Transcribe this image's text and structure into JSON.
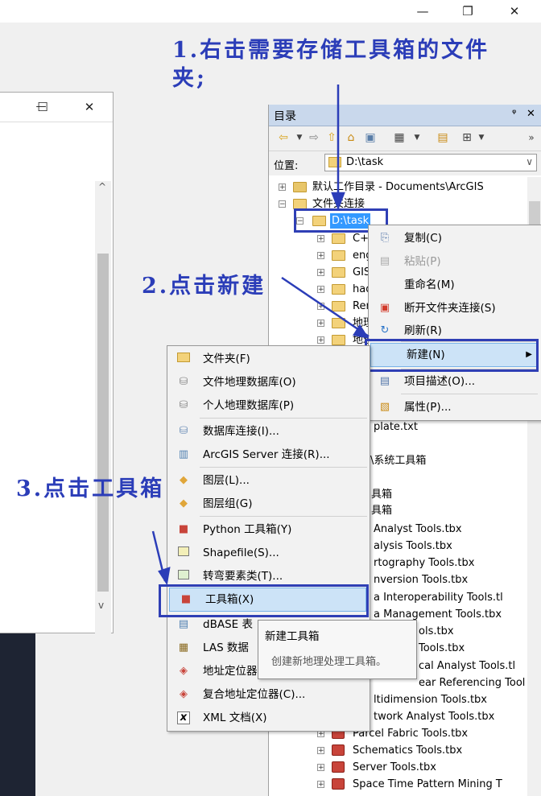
{
  "window": {
    "minimize_glyph": "—",
    "maximize_glyph": "❐",
    "close_glyph": "✕"
  },
  "left_window": {
    "minimize_glyph": "—",
    "maximize_glyph": "☐",
    "close_glyph": "✕",
    "scroll_up": "^",
    "scroll_down": "v"
  },
  "catalog": {
    "title": "目录",
    "pin_glyph": "ᵠ",
    "close_glyph": "✕",
    "location_label": "位置:",
    "location_value": "D:\\task",
    "tree": {
      "default_workspace": "默认工作目录 - Documents\\ArcGIS",
      "folder_connections": "文件夹连接",
      "task": "D:\\task",
      "children": [
        "C+",
        "eng",
        "GIS",
        "had",
        "Rer",
        "地理",
        "地理"
      ],
      "template": "plate.txt",
      "system_toolboxes": "\\系统工具箱",
      "toolbox_a": "具箱",
      "toolbox_b": "具箱",
      "items": [
        "Analyst Tools.tbx",
        "alysis Tools.tbx",
        "rtography Tools.tbx",
        "nversion Tools.tbx",
        "a Interoperability Tools.tl",
        "a Management Tools.tbx",
        "ols.tbx",
        "Tools.tbx",
        "cal Analyst Tools.tl",
        "ear Referencing Tools.tbx",
        "ltidimension Tools.tbx",
        "twork Analyst Tools.tbx",
        "Parcel Fabric Tools.tbx",
        "Schematics Tools.tbx",
        "Server Tools.tbx",
        "Space Time Pattern Mining T"
      ]
    }
  },
  "context_menu": {
    "items": [
      {
        "label": "复制(C)",
        "icon": "copy-icon",
        "disabled": false
      },
      {
        "label": "粘贴(P)",
        "icon": "paste-icon",
        "disabled": true
      },
      {
        "label": "重命名(M)",
        "icon": "",
        "disabled": false
      },
      {
        "label": "断开文件夹连接(S)",
        "icon": "disconnect-icon",
        "disabled": false
      },
      {
        "label": "刷新(R)",
        "icon": "refresh-icon",
        "disabled": false
      },
      {
        "label": "新建(N)",
        "icon": "",
        "disabled": false
      },
      {
        "label": "项目描述(O)...",
        "icon": "description-icon",
        "disabled": false
      },
      {
        "label": "属性(P)...",
        "icon": "properties-icon",
        "disabled": false
      }
    ],
    "submenu_arrow": "▶"
  },
  "new_submenu": {
    "items": [
      {
        "label": "文件夹(F)",
        "icon": "folder-icon"
      },
      {
        "label": "文件地理数据库(O)",
        "icon": "file-geodatabase-icon"
      },
      {
        "label": "个人地理数据库(P)",
        "icon": "personal-geodatabase-icon"
      },
      {
        "label": "数据库连接(I)...",
        "icon": "database-connection-icon"
      },
      {
        "label": "ArcGIS Server 连接(R)...",
        "icon": "server-connection-icon"
      },
      {
        "label": "图层(L)...",
        "icon": "layer-icon"
      },
      {
        "label": "图层组(G)",
        "icon": "layer-group-icon"
      },
      {
        "label": "Python 工具箱(Y)",
        "icon": "python-toolbox-icon"
      },
      {
        "label": "Shapefile(S)...",
        "icon": "shapefile-icon"
      },
      {
        "label": "转弯要素类(T)...",
        "icon": "turn-feature-icon"
      },
      {
        "label": "工具箱(X)",
        "icon": "toolbox-icon"
      },
      {
        "label": "dBASE 表",
        "icon": "dbase-icon"
      },
      {
        "label": "LAS 数据集",
        "icon": "las-dataset-icon"
      },
      {
        "label": "地址定位器",
        "icon": "address-locator-icon"
      },
      {
        "label": "复合地址定位器(C)...",
        "icon": "composite-locator-icon"
      },
      {
        "label": "XML 文档(X)",
        "icon": "xml-document-icon"
      }
    ]
  },
  "tooltip": {
    "title": "新建工具箱",
    "description": "创建新地理处理工具箱。"
  },
  "annotations": {
    "step1_line1": "1.右击需要存储工具箱的文件",
    "step1_line2": "夹;",
    "step2": "2.点击新建",
    "step3": "3.点击工具箱",
    "color": "#2b3db8"
  }
}
